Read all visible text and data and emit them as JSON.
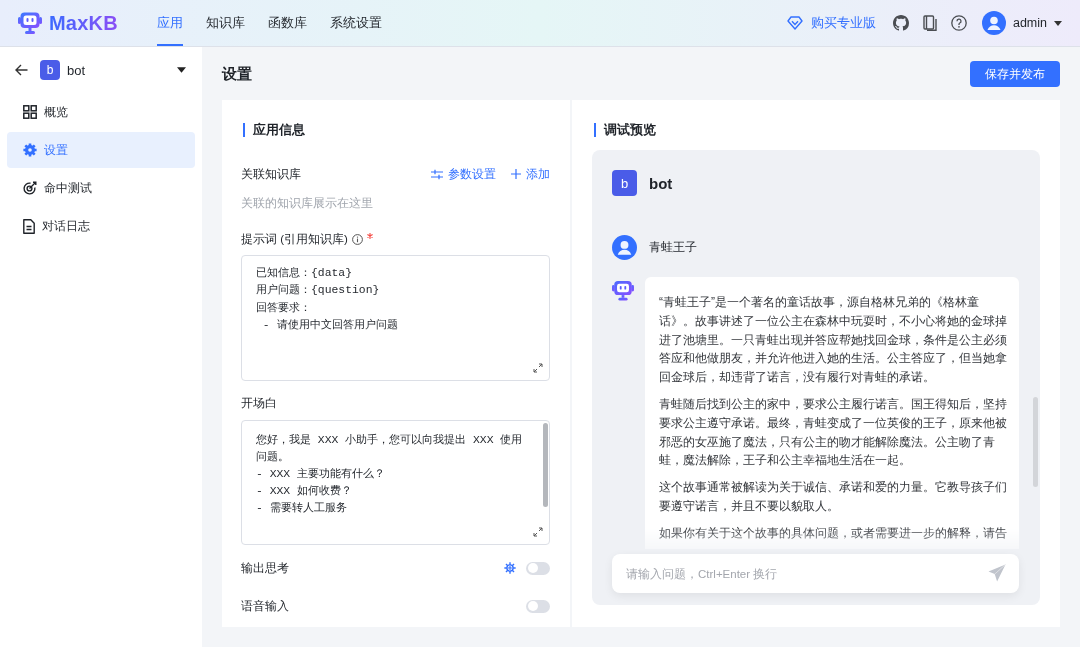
{
  "header": {
    "logo_text": "MaxKB",
    "nav": [
      {
        "label": "应用",
        "selected": true
      },
      {
        "label": "知识库",
        "selected": false
      },
      {
        "label": "函数库",
        "selected": false
      },
      {
        "label": "系统设置",
        "selected": false
      }
    ],
    "upgrade_link": "购买专业版",
    "user_name": "admin"
  },
  "sidebar": {
    "app_badge": "b",
    "app_name": "bot",
    "items": [
      {
        "label": "概览",
        "selected": false
      },
      {
        "label": "设置",
        "selected": true
      },
      {
        "label": "命中测试",
        "selected": false
      },
      {
        "label": "对话日志",
        "selected": false
      }
    ]
  },
  "page": {
    "title": "设置",
    "save_button": "保存并发布"
  },
  "app_info": {
    "title": "应用信息",
    "knowledge": {
      "label": "关联知识库",
      "actions": [
        "参数设置",
        "添加"
      ],
      "empty_text": "关联的知识库展示在这里"
    },
    "prompt": {
      "label": "提示词 (引用知识库)",
      "required": true,
      "value": "已知信息：{data}\n用户问题：{question}\n回答要求：\n - 请使用中文回答用户问题"
    },
    "opening": {
      "label": "开场白",
      "value": "您好，我是 XXX 小助手，您可以向我提出 XXX 使用问题。\n- XXX 主要功能有什么？\n- XXX 如何收费？\n- 需要转人工服务"
    },
    "switches": [
      {
        "label": "输出思考",
        "settings": true,
        "on": false
      },
      {
        "label": "语音输入",
        "settings": false,
        "on": false
      }
    ]
  },
  "preview": {
    "title": "调试预览",
    "bot_badge": "b",
    "bot_name": "bot",
    "messages": [
      {
        "kind": "user",
        "text": "青蛙王子"
      },
      {
        "kind": "bot",
        "paragraphs": [
          "“青蛙王子”是一个著名的童话故事，源自格林兄弟的《格林童话》。故事讲述了一位公主在森林中玩耍时，不小心将她的金球掉进了池塘里。一只青蛙出现并答应帮她找回金球，条件是公主必须答应和他做朋友，并允许他进入她的生活。公主答应了，但当她拿回金球后，却违背了诺言，没有履行对青蛙的承诺。",
          "青蛙随后找到公主的家中，要求公主履行诺言。国王得知后，坚持要求公主遵守承诺。最终，青蛙变成了一位英俊的王子，原来他被邪恶的女巫施了魔法，只有公主的吻才能解除魔法。公主吻了青蛙，魔法解除，王子和公主幸福地生活在一起。",
          "这个故事通常被解读为关于诚信、承诺和爱的力量。它教导孩子们要遵守诺言，并且不要以貌取人。",
          "如果你有关于这个故事的具体问题，或者需要进一步的解释，请告"
        ]
      }
    ],
    "input": {
      "placeholder": "请输入问题，Ctrl+Enter 换行"
    }
  }
}
